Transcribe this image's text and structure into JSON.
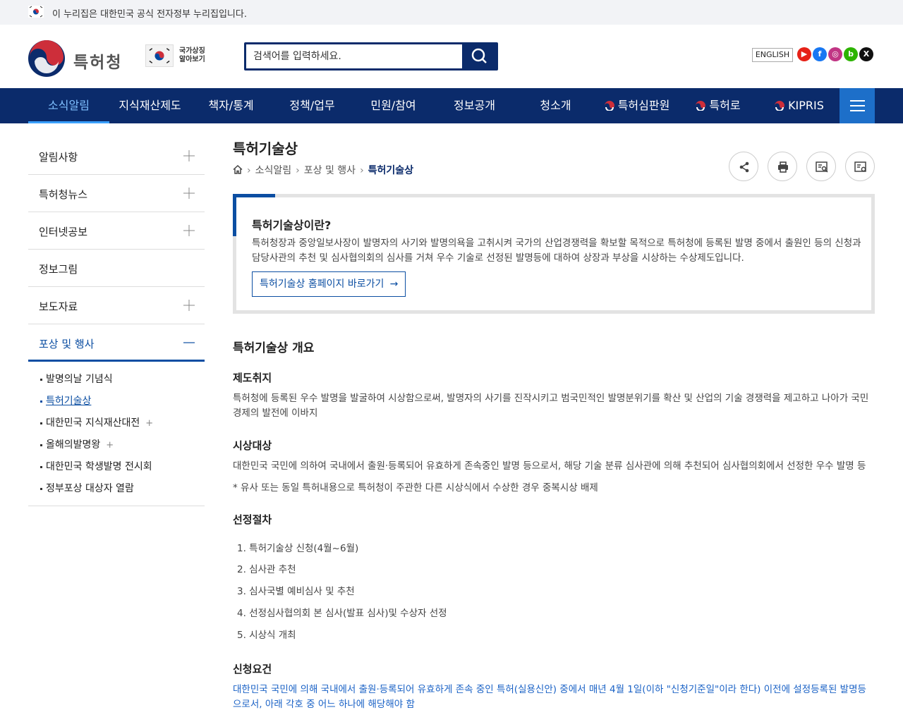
{
  "gov_bar": {
    "text": "이 누리집은 대한민국 공식 전자정부 누리집입니다."
  },
  "header": {
    "logo_text": "특허청",
    "symbol_line1": "국가상징",
    "symbol_line2": "알아보기",
    "search_placeholder": "검색어를 입력하세요.",
    "english_label": "ENGLISH",
    "sns": [
      "youtube-icon",
      "facebook-icon",
      "instagram-icon",
      "blog-icon",
      "x-icon"
    ]
  },
  "gnb": {
    "items": [
      "소식알림",
      "지식재산제도",
      "책자/통계",
      "정책/업무",
      "민원/참여",
      "정보공개",
      "청소개"
    ],
    "links": [
      "특허심판원",
      "특허로",
      "KIPRIS"
    ],
    "active_index": 0
  },
  "lnb": {
    "items": [
      "알림사항",
      "특허청뉴스",
      "인터넷공보",
      "정보그림",
      "보도자료",
      "포상 및 행사"
    ],
    "sub_items": [
      "발명의날 기념식",
      "특허기술상",
      "대한민국 지식재산대전",
      "올해의발명왕",
      "대한민국 학생발명 전시회",
      "정부포상 대상자 열람"
    ]
  },
  "page": {
    "title": "특허기술상",
    "breadcrumb": [
      "소식알림",
      "포상 및 행사",
      "특허기술상"
    ],
    "intro_title": "특허기술상이란?",
    "intro_text": "특허청장과 중앙일보사장이 발명자의 사기와 발명의욕을 고취시켜 국가의 산업경쟁력을 확보할 목적으로 특허청에 등록된 발명 중에서 출원인 등의 신청과 담당사관의 추천 및 심사협의회의 심사를 거쳐 우수 기술로 선정된 발명등에 대하여 상장과 부상을 시상하는 수상제도입니다.",
    "intro_button": "특허기술상 홈페이지 바로가기",
    "overview_title": "특허기술상 개요",
    "purpose_title": "제도취지",
    "purpose_text": "특허청에 등록된 우수 발명을 발굴하여 시상함으로써, 발명자의 사기를 진작시키고 범국민적인 발명분위기를 확산 및 산업의 기술 경쟁력을 제고하고 나아가 국민경제의 발전에 이바지",
    "target_title": "시상대상",
    "target_text": "대한민국 국민에 의하여 국내에서 출원·등록되어 유효하게 존속중인 발명 등으로서, 해당 기술 분류 심사관에 의해 추천되어 심사협의회에서 선정한 우수 발명 등",
    "target_note": "* 유사 또는 동일 특허내용으로 특허청이 주관한 다른 시상식에서 수상한 경우 중복시상 배제",
    "process_title": "선정절차",
    "process_steps": [
      "1. 특허기술상 신청(4월~6월)",
      "2. 심사관 추천",
      "3. 심사국별 예비심사 및 추천",
      "4. 선정심사협의회 본 심사(발표 심사)및 수상자 선정",
      "5. 시상식 개최"
    ],
    "req_title": "신청요건",
    "req_text": "대한민국 국민에 의해 국내에서 출원·등록되어 유효하게 존속 중인 특허(실용신안) 중에서 매년 4월 1일(이하 \"신청기준일\"이라 한다) 이전에 설정등록된 발명등으로서, 아래 각호 중 어느 하나에 해당해야 함"
  }
}
